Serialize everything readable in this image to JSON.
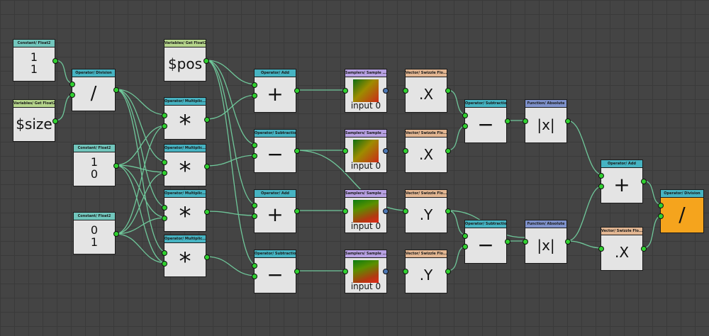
{
  "nodes": {
    "c11": {
      "title": "Constant/ Float2",
      "v1": "1",
      "v2": "1"
    },
    "vsize": {
      "title": "Variables/ Get Float2",
      "value": "$size"
    },
    "div1": {
      "title": "Operator/ Division",
      "symbol": "/"
    },
    "vpos": {
      "title": "Variables/ Get Float2",
      "value": "$pos"
    },
    "c10": {
      "title": "Constant/ Float2",
      "v1": "1",
      "v2": "0"
    },
    "c01": {
      "title": "Constant/ Float2",
      "v1": "0",
      "v2": "1"
    },
    "mul1": {
      "title": "Operator/ Multiplic...",
      "symbol": "*"
    },
    "mul2": {
      "title": "Operator/ Multiplic...",
      "symbol": "*"
    },
    "mul3": {
      "title": "Operator/ Multiplic...",
      "symbol": "*"
    },
    "mul4": {
      "title": "Operator/ Multiplic...",
      "symbol": "*"
    },
    "add1": {
      "title": "Operator/ Add",
      "symbol": "+"
    },
    "sub1": {
      "title": "Operator/ Subtraction",
      "symbol": "−"
    },
    "add2": {
      "title": "Operator/ Add",
      "symbol": "+"
    },
    "sub2": {
      "title": "Operator/ Subtraction",
      "symbol": "−"
    },
    "samp1": {
      "title": "Samplers/ Sample ...",
      "caption": "input 0"
    },
    "samp2": {
      "title": "Samplers/ Sample ...",
      "caption": "input 0"
    },
    "samp3": {
      "title": "Samplers/ Sample ...",
      "caption": "input 0"
    },
    "samp4": {
      "title": "Samplers/ Sample ...",
      "caption": "input 0"
    },
    "swz1": {
      "title": "Vector/ Swizzle Flo...",
      "symbol": ".X"
    },
    "swz2": {
      "title": "Vector/ Swizzle Flo...",
      "symbol": ".X"
    },
    "swz3": {
      "title": "Vector/ Swizzle Flo...",
      "symbol": ".Y"
    },
    "swz4": {
      "title": "Vector/ Swizzle Flo...",
      "symbol": ".Y"
    },
    "sub3": {
      "title": "Operator/ Subtraction",
      "symbol": "−"
    },
    "sub4": {
      "title": "Operator/ Subtraction",
      "symbol": "−"
    },
    "abs1": {
      "title": "Function/ Absolute",
      "symbol": "|x|"
    },
    "abs2": {
      "title": "Function/ Absolute",
      "symbol": "|x|"
    },
    "add3": {
      "title": "Operator/ Add",
      "symbol": "+"
    },
    "swz5": {
      "title": "Vector/ Swizzle Flo...",
      "symbol": ".X"
    },
    "div2": {
      "title": "Operator/ Division",
      "symbol": "/"
    }
  },
  "colors": {
    "background": "#444444",
    "wire": "#6fc79a",
    "pin": "#2fd02f",
    "pin_texture": "#4c76b2",
    "output_node": "#f5a41d"
  }
}
